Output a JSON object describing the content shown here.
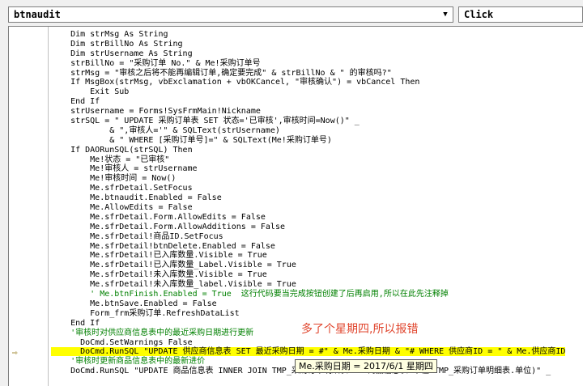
{
  "object_combo": {
    "value": "btnaudit"
  },
  "procedure_combo": {
    "value": "Click"
  },
  "code_lines": [
    {
      "text": "    Dim strMsg As String",
      "type": "code"
    },
    {
      "text": "    Dim strBillNo As String",
      "type": "code"
    },
    {
      "text": "    Dim strUsername As String",
      "type": "code"
    },
    {
      "text": "    strBillNo = \"采购订单 No.\" & Me!采购订单号",
      "type": "code"
    },
    {
      "text": "    strMsg = \"审核之后将不能再编辑订单,确定要完成\" & strBillNo & \" 的审核吗?\"",
      "type": "code"
    },
    {
      "text": "    If MsgBox(strMsg, vbExclamation + vbOKCancel, \"审核确认\") = vbCancel Then",
      "type": "code"
    },
    {
      "text": "        Exit Sub",
      "type": "code"
    },
    {
      "text": "    End If",
      "type": "code"
    },
    {
      "text": "    strUsername = Forms!SysFrmMain!Nickname",
      "type": "code"
    },
    {
      "text": "    strSQL = \" UPDATE 采购订单表 SET 状态='已审核',审核时间=Now()\" _",
      "type": "code"
    },
    {
      "text": "            & \",审核人='\" & SQLText(strUsername)",
      "type": "code"
    },
    {
      "text": "            & \" WHERE [采购订单号]=\" & SQLText(Me!采购订单号)",
      "type": "code"
    },
    {
      "text": "    If DAORunSQL(strSQL) Then",
      "type": "code"
    },
    {
      "text": "        Me!状态 = \"已审核\"",
      "type": "code"
    },
    {
      "text": "        Me!审核人 = strUsername",
      "type": "code"
    },
    {
      "text": "        Me!审核时间 = Now()",
      "type": "code"
    },
    {
      "text": "        Me.sfrDetail.SetFocus",
      "type": "code"
    },
    {
      "text": "        Me.btnaudit.Enabled = False",
      "type": "code"
    },
    {
      "text": "        Me.AllowEdits = False",
      "type": "code"
    },
    {
      "text": "        Me.sfrDetail.Form.AllowEdits = False",
      "type": "code"
    },
    {
      "text": "        Me.sfrDetail.Form.AllowAdditions = False",
      "type": "code"
    },
    {
      "text": "        Me.sfrDetail!商品ID.SetFocus",
      "type": "code"
    },
    {
      "text": "        Me.sfrDetail!btnDelete.Enabled = False",
      "type": "code"
    },
    {
      "text": "        Me.sfrDetail!已入库数量.Visible = True",
      "type": "code"
    },
    {
      "text": "        Me.sfrDetail!已入库数量_Label.Visible = True",
      "type": "code"
    },
    {
      "text": "        Me.sfrDetail!未入库数量.Visible = True",
      "type": "code"
    },
    {
      "text": "        Me.sfrDetail!未入库数量_label.Visible = True",
      "type": "code"
    },
    {
      "text": "        ' Me.btnFinish.Enabled = True  这行代码要当完成按钮创建了后再启用,所以在此先注释掉",
      "type": "comment"
    },
    {
      "text": "        Me.btnSave.Enabled = False",
      "type": "code"
    },
    {
      "text": "        Form_frm采购订单.RefreshDataList",
      "type": "code"
    },
    {
      "text": "    End If",
      "type": "code"
    },
    {
      "text": "    '审核时对供应商信息表中的最近采购日期进行更新",
      "type": "comment"
    },
    {
      "text": "      DoCmd.SetWarnings False",
      "type": "code"
    },
    {
      "text": "      DoCmd.RunSQL \"UPDATE 供应商信息表 SET 最近采购日期 = #\" & Me.采购日期 & \"# WHERE 供应商ID = \" & Me.供应商ID",
      "type": "highlight"
    },
    {
      "text": "    '审核时更新商品信息表中的最新进价",
      "type": "comment"
    },
    {
      "text": "    DoCmd.RunSQL \"UPDATE 商品信息表 INNER JOIN TMP_采购订单明细表 ON 商品信息表.单位=TMP_采购订单明细表.单位)\" _",
      "type": "code"
    }
  ],
  "annotation": {
    "text": "多了个星期四,所以报错"
  },
  "tooltip": {
    "text": "Me.采购日期 = 2017/6/1 星期四"
  },
  "icons": {
    "execution_arrow": "current-line-arrow-icon",
    "dropdown": "dropdown-arrow-icon"
  }
}
